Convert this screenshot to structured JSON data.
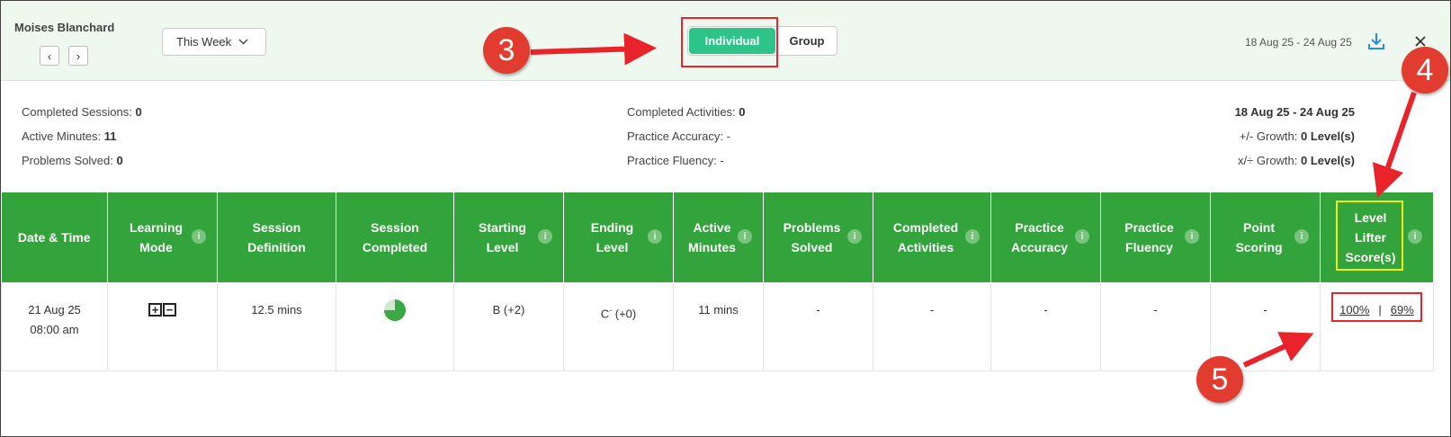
{
  "header": {
    "student_name": "Moises Blanchard",
    "prev_icon": "chevron-left-icon",
    "next_icon": "chevron-right-icon",
    "period": "This Week",
    "toggle": {
      "individual": "Individual",
      "group": "Group",
      "active": "individual"
    },
    "date_range": "18 Aug 25 - 24 Aug 25"
  },
  "summary": {
    "left": [
      {
        "label": "Completed Sessions:",
        "value": "0"
      },
      {
        "label": "Active Minutes:",
        "value": "11"
      },
      {
        "label": "Problems Solved:",
        "value": "0"
      }
    ],
    "middle": [
      {
        "label": "Completed Activities:",
        "value": "0"
      },
      {
        "label": "Practice Accuracy:",
        "value": "-"
      },
      {
        "label": "Practice Fluency:",
        "value": "-"
      }
    ],
    "right": {
      "range": "18 Aug 25 - 24 Aug 25",
      "growth_add": {
        "label": "+/- Growth:",
        "value": "0 Level(s)"
      },
      "growth_mul": {
        "label": "x/÷ Growth:",
        "value": "0 Level(s)"
      }
    }
  },
  "table": {
    "columns": [
      {
        "line1": "Date & Time",
        "line2": ""
      },
      {
        "line1": "Learning",
        "line2": "Mode"
      },
      {
        "line1": "Session",
        "line2": "Definition"
      },
      {
        "line1": "Session",
        "line2": "Completed"
      },
      {
        "line1": "Starting",
        "line2": "Level"
      },
      {
        "line1": "Ending",
        "line2": "Level"
      },
      {
        "line1": "Active",
        "line2": "Minutes"
      },
      {
        "line1": "Problems",
        "line2": "Solved"
      },
      {
        "line1": "Completed",
        "line2": "Activities"
      },
      {
        "line1": "Practice",
        "line2": "Accuracy"
      },
      {
        "line1": "Practice",
        "line2": "Fluency"
      },
      {
        "line1": "Point",
        "line2": "Scoring"
      },
      {
        "line1": "Level",
        "line2": "Lifter",
        "line3": "Score(s)"
      }
    ],
    "info_glyph": "i",
    "row": {
      "date": "21 Aug 25",
      "time": "08:00 am",
      "mode_plus": "+",
      "mode_minus": "−",
      "session_definition": "12.5 mins",
      "session_completed_fraction": 0.75,
      "starting_level": "B (+2)",
      "ending_level_base": "C",
      "ending_level_sup": "-",
      "ending_level_rest": " (+0)",
      "active_minutes": "11 mins",
      "problems_solved": "-",
      "completed_activities": "-",
      "practice_accuracy": "-",
      "practice_fluency": "-",
      "point_scoring": "-",
      "score_1": "100%",
      "score_sep": "|",
      "score_2": "69%"
    }
  },
  "callouts": [
    "3",
    "4",
    "5"
  ],
  "colors": {
    "header_bg": "#eef8ef",
    "toggle_active": "#2ec489",
    "table_header": "#33a43c",
    "callout": "#e23b2f",
    "highlight_red": "#e8232a",
    "highlight_yellow": "#f4ef11",
    "download_icon": "#2b8de0"
  }
}
